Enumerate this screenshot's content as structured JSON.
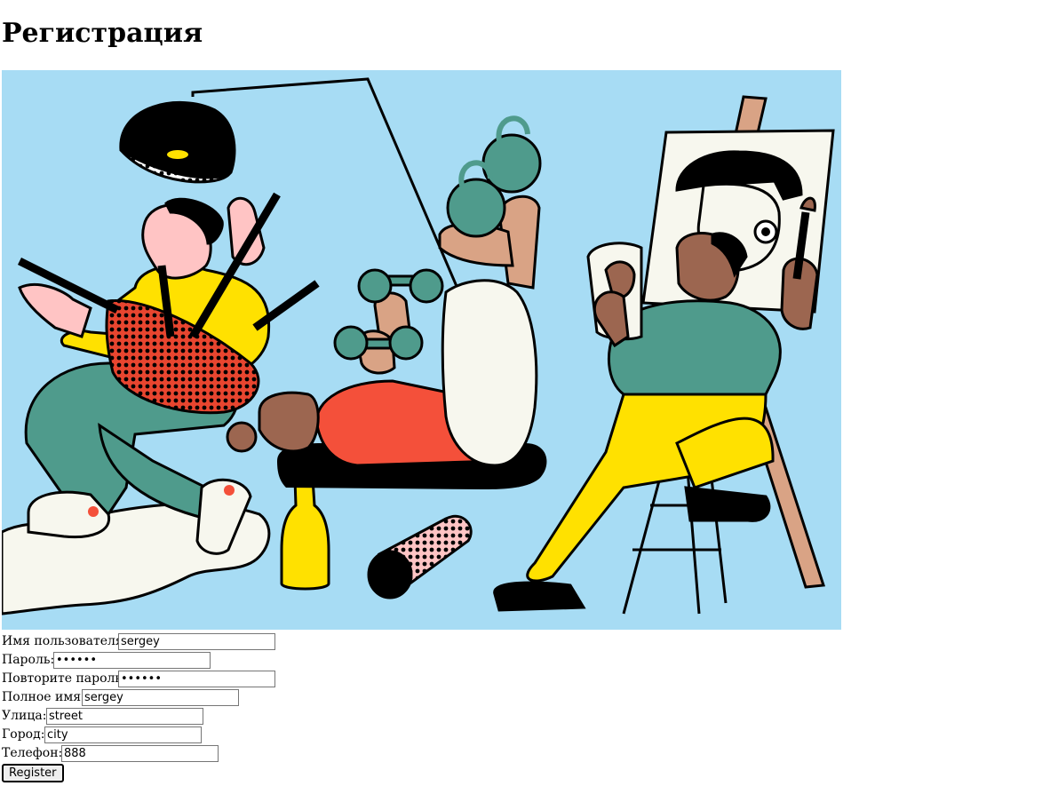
{
  "page": {
    "title": "Регистрация"
  },
  "form": {
    "username_label": "Имя пользователя:",
    "username_value": "sergey",
    "password_label": "Пароль:",
    "password_value": "••••••",
    "confirm_label": "Повторите пароль:",
    "confirm_value": "••••••",
    "fullname_label": "Полное имя:",
    "fullname_value": "sergey",
    "street_label": "Улица:",
    "street_value": "street",
    "city_label": "Город:",
    "city_value": "city",
    "phone_label": "Телефон:",
    "phone_value": "888",
    "submit_label": "Register"
  },
  "colors": {
    "sky": "#a7dcf4",
    "teal": "#4f9b8c",
    "yellow": "#ffe100",
    "red": "#f4503a",
    "skin_light": "#ffc4c4",
    "skin_tan": "#d9a385",
    "skin_dark": "#9c6650",
    "cream": "#f7f7ee"
  }
}
